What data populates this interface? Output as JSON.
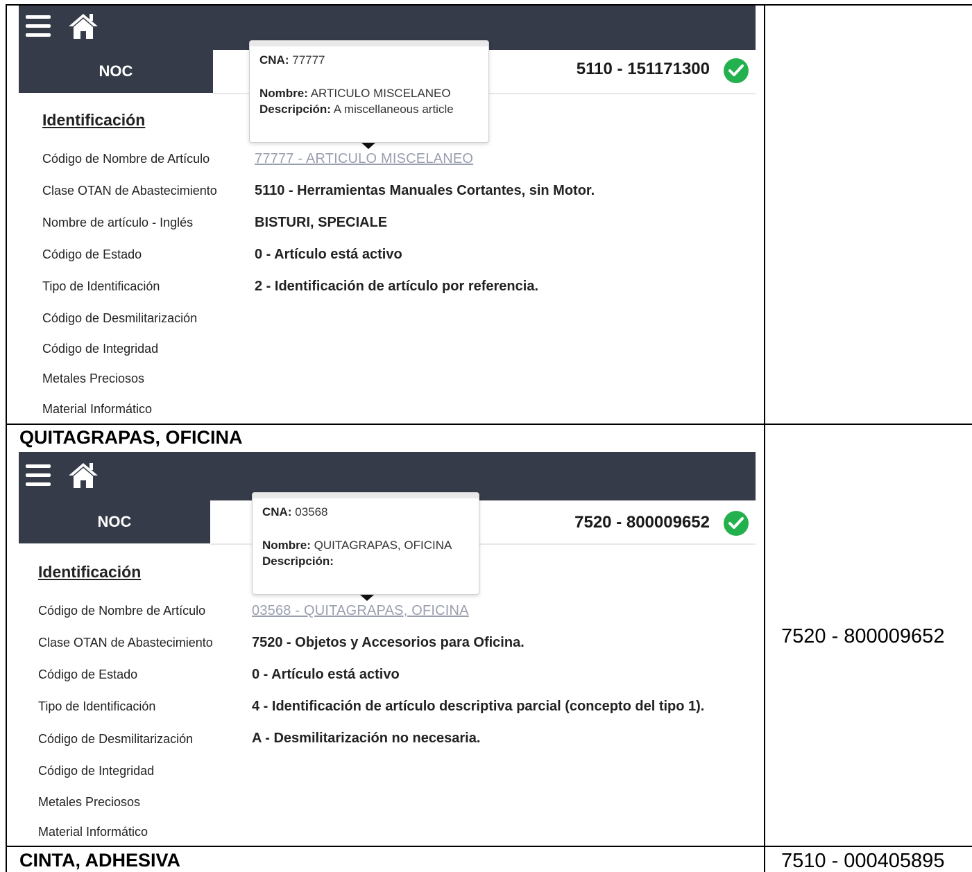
{
  "panels": [
    {
      "menu_icon": "hamburger-menu-icon",
      "home_icon": "home-icon",
      "noc_tab": "NOC",
      "noc_code": "5110 - 151171300",
      "status_icon": "check-circle-icon",
      "section_title": "Identificación",
      "tooltip": {
        "cna_label": "CNA:",
        "cna_value": "77777",
        "nombre_label": "Nombre:",
        "nombre_value": "ARTICULO MISCELANEO",
        "descripcion_label": "Descripción:",
        "descripcion_value": "A miscellaneous article"
      },
      "fields": [
        {
          "label": "Código de Nombre de Artículo",
          "value": "77777 - ARTICULO MISCELANEO",
          "link": true
        },
        {
          "label": "Clase OTAN de Abastecimiento",
          "value": "5110 - Herramientas Manuales Cortantes, sin Motor."
        },
        {
          "label": "Nombre de artículo - Inglés",
          "value": "BISTURI, SPECIALE"
        },
        {
          "label": "Código de Estado",
          "value": "0 - Artículo está activo"
        },
        {
          "label": "Tipo de Identificación",
          "value": "2 - Identificación de artículo por referencia."
        },
        {
          "label": "Código de Desmilitarización",
          "value": ""
        },
        {
          "label": "Código de Integridad",
          "value": ""
        },
        {
          "label": "Metales Preciosos",
          "value": ""
        },
        {
          "label": "Material Informático",
          "value": ""
        }
      ]
    },
    {
      "menu_icon": "hamburger-menu-icon",
      "home_icon": "home-icon",
      "noc_tab": "NOC",
      "noc_code": "7520 - 800009652",
      "status_icon": "check-circle-icon",
      "section_title": "Identificación",
      "tooltip": {
        "cna_label": "CNA:",
        "cna_value": "03568",
        "nombre_label": "Nombre:",
        "nombre_value": "QUITAGRAPAS, OFICINA",
        "descripcion_label": "Descripción:",
        "descripcion_value": ""
      },
      "fields": [
        {
          "label": "Código de Nombre de Artículo",
          "value": "03568 - QUITAGRAPAS, OFICINA",
          "link": true
        },
        {
          "label": "Clase OTAN de Abastecimiento",
          "value": "7520 - Objetos y Accesorios para Oficina."
        },
        {
          "label": "Código de Estado",
          "value": "0 - Artículo está activo"
        },
        {
          "label": "Tipo de Identificación",
          "value": "4 - Identificación de artículo descriptiva parcial (concepto del tipo 1)."
        },
        {
          "label": "Código de Desmilitarización",
          "value": "A - Desmilitarización no necesaria."
        },
        {
          "label": "Código de Integridad",
          "value": ""
        },
        {
          "label": "Metales Preciosos",
          "value": ""
        },
        {
          "label": "Material Informático",
          "value": ""
        }
      ]
    }
  ],
  "rows": [
    {
      "title": "QUITAGRAPAS, OFICINA",
      "right": "7520 - 800009652"
    },
    {
      "title": "CINTA, ADHESIVA",
      "right": "7510 - 000405895"
    }
  ]
}
